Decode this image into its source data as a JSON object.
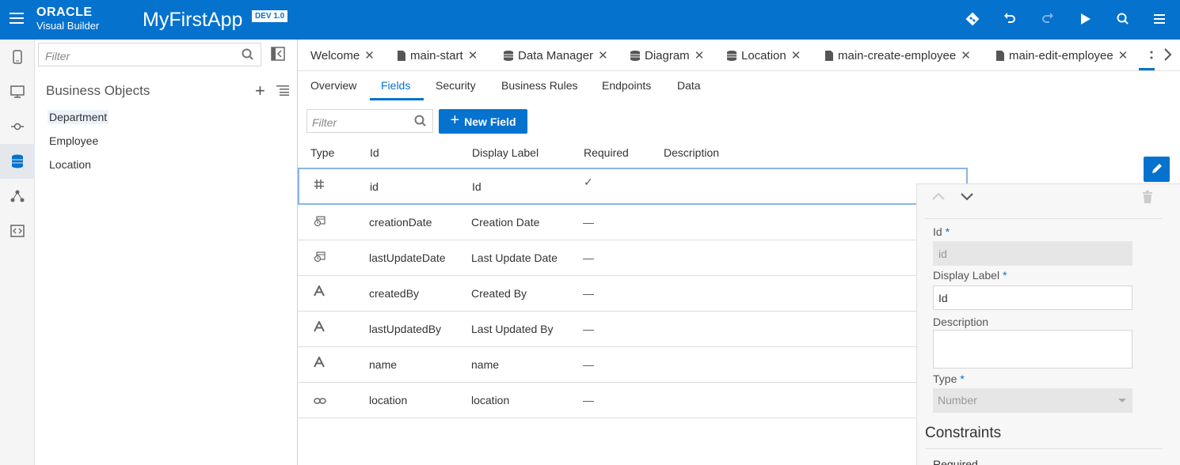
{
  "header": {
    "brand_line1": "ORACLE",
    "brand_line2": "Visual Builder",
    "app_name": "MyFirstApp",
    "version_badge": "DEV 1.0",
    "accent_color": "#0572ce"
  },
  "rail": {
    "items": [
      "mobile-icon",
      "web-icon",
      "service-connections-icon",
      "business-objects-icon",
      "processes-icon",
      "source-view-icon"
    ],
    "active_index": 3
  },
  "navigator": {
    "filter_placeholder": "Filter",
    "heading": "Business Objects",
    "items": [
      {
        "label": "Department"
      },
      {
        "label": "Employee"
      },
      {
        "label": "Location"
      }
    ]
  },
  "tabs": [
    {
      "label": "Welcome",
      "icon": "none"
    },
    {
      "label": "main-start",
      "icon": "page-icon"
    },
    {
      "label": "Data Manager",
      "icon": "database-icon"
    },
    {
      "label": "Diagram",
      "icon": "database-icon"
    },
    {
      "label": "Location",
      "icon": "database-icon"
    },
    {
      "label": "main-create-employee",
      "icon": "page-icon"
    },
    {
      "label": "main-edit-employee",
      "icon": "page-icon"
    }
  ],
  "subtabs": [
    {
      "label": "Overview"
    },
    {
      "label": "Fields"
    },
    {
      "label": "Security"
    },
    {
      "label": "Business Rules"
    },
    {
      "label": "Endpoints"
    },
    {
      "label": "Data"
    }
  ],
  "active_subtab": "Fields",
  "fields_toolbar": {
    "filter_placeholder": "Filter",
    "new_field_label": "New Field"
  },
  "table": {
    "headers": {
      "type": "Type",
      "id": "Id",
      "label": "Display Label",
      "required": "Required",
      "description": "Description"
    },
    "rows": [
      {
        "type_icon": "number-icon",
        "id": "id",
        "label": "Id",
        "required": "✓"
      },
      {
        "type_icon": "datetime-icon",
        "id": "creationDate",
        "label": "Creation Date",
        "required": "—"
      },
      {
        "type_icon": "datetime-icon",
        "id": "lastUpdateDate",
        "label": "Last Update Date",
        "required": "—"
      },
      {
        "type_icon": "string-icon",
        "id": "createdBy",
        "label": "Created By",
        "required": "—"
      },
      {
        "type_icon": "string-icon",
        "id": "lastUpdatedBy",
        "label": "Last Updated By",
        "required": "—"
      },
      {
        "type_icon": "string-icon",
        "id": "name",
        "label": "name",
        "required": "—"
      },
      {
        "type_icon": "reference-icon",
        "id": "location",
        "label": "location",
        "required": "—"
      }
    ]
  },
  "panel": {
    "id_label": "Id",
    "id_value": "id",
    "display_label_label": "Display Label",
    "display_label_value": "Id",
    "description_label": "Description",
    "description_value": "",
    "type_label": "Type",
    "type_value": "Number",
    "required_marker": "*",
    "constraints_heading": "Constraints",
    "clipped_text": "Required"
  }
}
